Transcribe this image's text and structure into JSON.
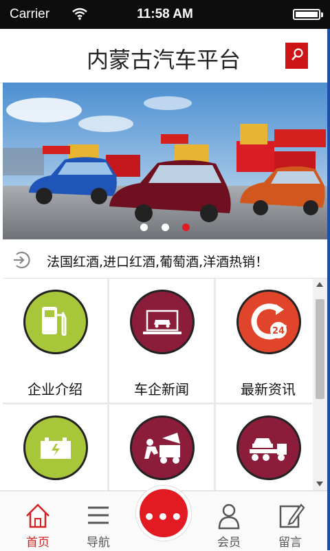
{
  "status_bar": {
    "carrier": "Carrier",
    "time": "11:58 AM"
  },
  "header": {
    "title": "内蒙古汽车平台"
  },
  "banner": {
    "active_dot": 3,
    "dot_count": 3
  },
  "notice": {
    "text": "法国红酒,进口红酒,葡萄酒,洋酒热销！"
  },
  "grid": {
    "items": [
      {
        "label": "企业介绍",
        "icon": "fuel-pump-icon",
        "color": "#a8c63a"
      },
      {
        "label": "车企新闻",
        "icon": "laptop-car-icon",
        "color": "#8c1d3a"
      },
      {
        "label": "最新资讯",
        "icon": "24-hour-icon",
        "color": "#e0442a"
      },
      {
        "label": "",
        "icon": "battery-icon",
        "color": "#a8c63a"
      },
      {
        "label": "",
        "icon": "mechanic-icon",
        "color": "#8c1d3a"
      },
      {
        "label": "",
        "icon": "tow-truck-icon",
        "color": "#8c1d3a"
      }
    ]
  },
  "tabbar": {
    "home": "首页",
    "nav": "导航",
    "center": "•••",
    "member": "会员",
    "message": "留言"
  },
  "colors": {
    "brand_red": "#e21b23",
    "active_tab": "#d4201f"
  }
}
